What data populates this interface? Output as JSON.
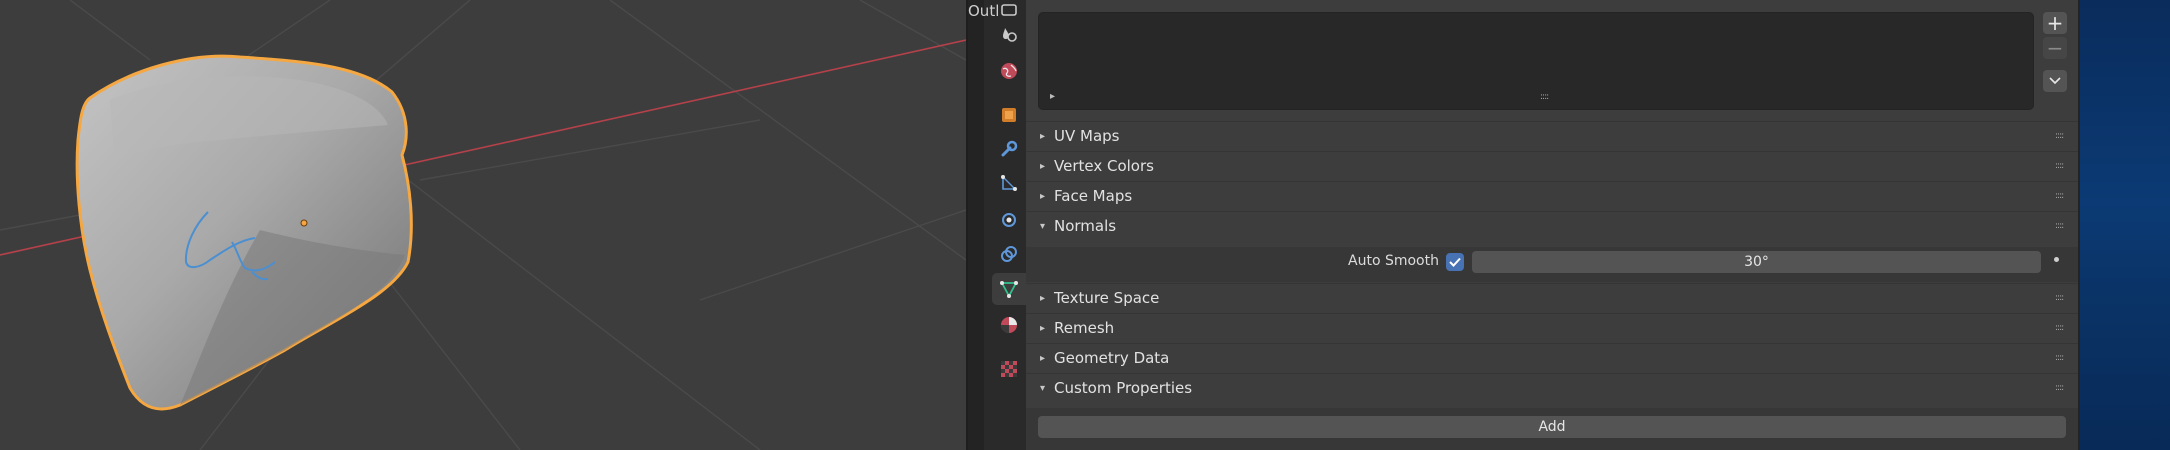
{
  "outliner": {
    "label": "Outl"
  },
  "properties": {
    "uv_list": {
      "add": "+",
      "remove": "−",
      "menu": "⌄",
      "expand": "▸",
      "grip": "::::"
    },
    "panels": [
      {
        "label": "UV Maps",
        "expanded": false
      },
      {
        "label": "Vertex Colors",
        "expanded": false
      },
      {
        "label": "Face Maps",
        "expanded": false
      },
      {
        "label": "Normals",
        "expanded": true
      },
      {
        "label": "Texture Space",
        "expanded": false
      },
      {
        "label": "Remesh",
        "expanded": false
      },
      {
        "label": "Geometry Data",
        "expanded": false
      },
      {
        "label": "Custom Properties",
        "expanded": true
      }
    ],
    "collapsed_arrow": "▸",
    "expanded_arrow": "▾",
    "grip": "::::",
    "normals": {
      "auto_smooth_label": "Auto Smooth",
      "auto_smooth_checked": true,
      "angle": "30°"
    },
    "custom_properties": {
      "add_label": "Add"
    }
  },
  "tabs": [
    {
      "name": "tool-tab",
      "icon": "tool-icon"
    },
    {
      "name": "world-particles-tab",
      "icon": "world-icon"
    },
    {
      "name": "world-tab",
      "icon": "world-icon"
    },
    {
      "name": "object-tab",
      "icon": "object-icon"
    },
    {
      "name": "modifiers-tab",
      "icon": "wrench-icon"
    },
    {
      "name": "particles-tab",
      "icon": "particles-icon"
    },
    {
      "name": "physics-tab",
      "icon": "physics-icon"
    },
    {
      "name": "constraints-tab",
      "icon": "constraints-icon"
    },
    {
      "name": "data-tab",
      "icon": "mesh-data-icon",
      "active": true
    },
    {
      "name": "material-tab",
      "icon": "material-icon"
    },
    {
      "name": "texture-tab",
      "icon": "texture-icon"
    }
  ],
  "colors": {
    "accent": "#4772b3",
    "selection_outline": "#f5a742",
    "x_axis": "#b5414a",
    "annotation": "#4b8fd0"
  }
}
